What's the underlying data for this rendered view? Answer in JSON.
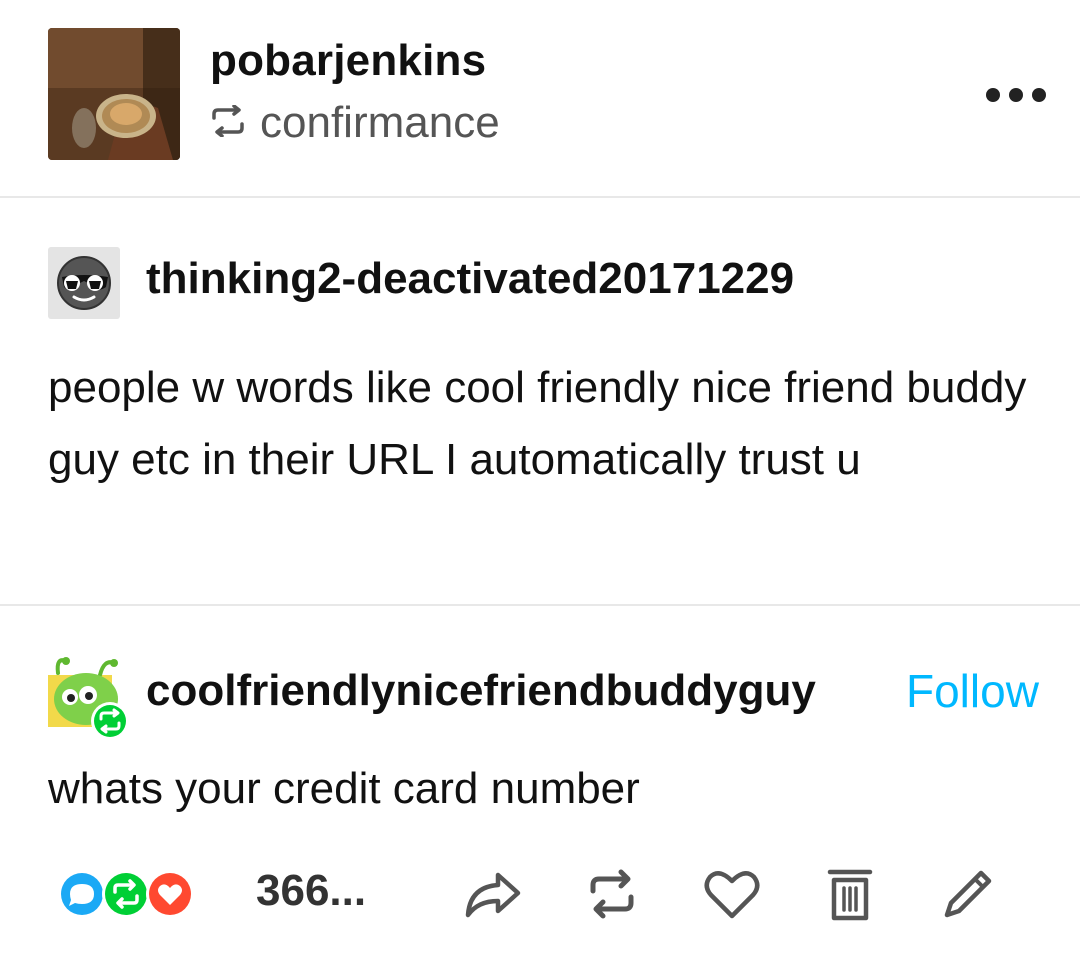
{
  "header": {
    "username": "pobarjenkins",
    "reblogged_from": "confirmance",
    "more_icon": "ellipsis-icon"
  },
  "original_post": {
    "username": "thinking2-deactivated20171229",
    "text": "people w words like cool friendly nice friend buddy guy etc in their URL I automatically trust u"
  },
  "reply": {
    "username": "coolfriendlynicefriendbuddyguy",
    "follow_label": "Follow",
    "text": "whats your credit card number"
  },
  "footer": {
    "note_count": "366...",
    "actions": [
      "share-icon",
      "reblog-icon",
      "like-icon",
      "delete-icon",
      "edit-icon"
    ]
  },
  "colors": {
    "accent": "#00b8ff",
    "comment_blue": "#1ba9f5",
    "reblog_green": "#00cf35",
    "like_red": "#ff4930"
  }
}
